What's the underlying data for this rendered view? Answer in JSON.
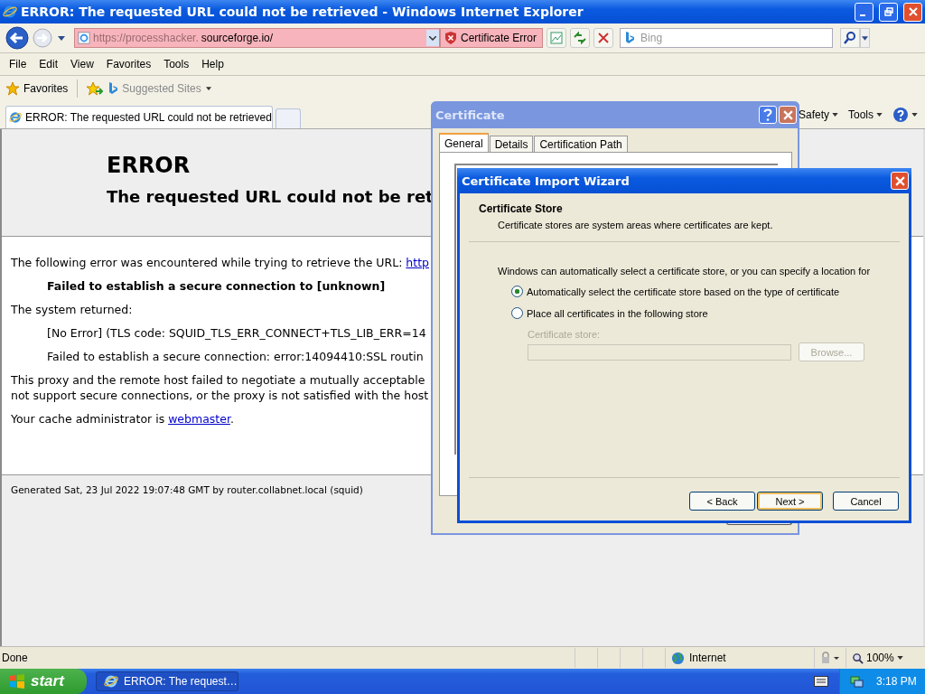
{
  "window": {
    "title": "ERROR: The requested URL could not be retrieved - Windows Internet Explorer"
  },
  "address_bar": {
    "url_prefix": "https://processhacker.",
    "url_domain": "sourceforge.io/",
    "certificate_error": "Certificate Error"
  },
  "search": {
    "placeholder": "Bing"
  },
  "menu": [
    "File",
    "Edit",
    "View",
    "Favorites",
    "Tools",
    "Help"
  ],
  "favorites_bar": {
    "favorites": "Favorites",
    "suggested_sites": "Suggested Sites"
  },
  "tabs": [
    {
      "label": "ERROR: The requested URL could not be retrieved",
      "selected": true
    }
  ],
  "command_bar": [
    "Safety",
    "Tools"
  ],
  "page": {
    "heading": "ERROR",
    "subheading": "The requested URL could not be ret",
    "intro": "The following error was encountered while trying to retrieve the URL: ",
    "intro_link": "http",
    "error_title": "Failed to establish a secure connection to [unknown]",
    "system_returned": "The system returned:",
    "details": [
      "[No Error] (TLS code: SQUID_TLS_ERR_CONNECT+TLS_LIB_ERR=14",
      "Failed to establish a secure connection: error:14094410:SSL routin"
    ],
    "explanation": [
      "This proxy and the remote host failed to negotiate a mutually acceptable",
      "not support secure connections, or the proxy is not satisfied with the host"
    ],
    "admin_text": "Your cache administrator is ",
    "admin_link": "webmaster",
    "admin_end": ".",
    "footer": "Generated Sat, 23 Jul 2022 19:07:48 GMT by router.collabnet.local (squid)"
  },
  "status_bar": {
    "status": "Done",
    "zone": "Internet",
    "zoom": "100%"
  },
  "taskbar": {
    "start": "start",
    "task": "ERROR: The request…",
    "clock": "3:18 PM"
  },
  "certificate_dialog": {
    "title": "Certificate",
    "tabs": [
      {
        "label": "General",
        "selected": true
      },
      {
        "label": "Details",
        "selected": false
      },
      {
        "label": "Certification Path",
        "selected": false
      }
    ]
  },
  "wizard": {
    "title": "Certificate Import Wizard",
    "section_title": "Certificate Store",
    "section_desc": "Certificate stores are system areas where certificates are kept.",
    "intro": "Windows can automatically select a certificate store, or you can specify a location for",
    "options": [
      {
        "label": "Automatically select the certificate store based on the type of certificate",
        "selected": true
      },
      {
        "label": "Place all certificates in the following store",
        "selected": false
      }
    ],
    "store_label": "Certificate store:",
    "store_field": {
      "disabled": true
    },
    "browse": {
      "label": "Browse...",
      "disabled": true
    },
    "buttons": [
      {
        "label": "< Back",
        "default": false
      },
      {
        "label": "Next >",
        "default": true
      },
      {
        "label": "Cancel",
        "default": false
      }
    ]
  }
}
